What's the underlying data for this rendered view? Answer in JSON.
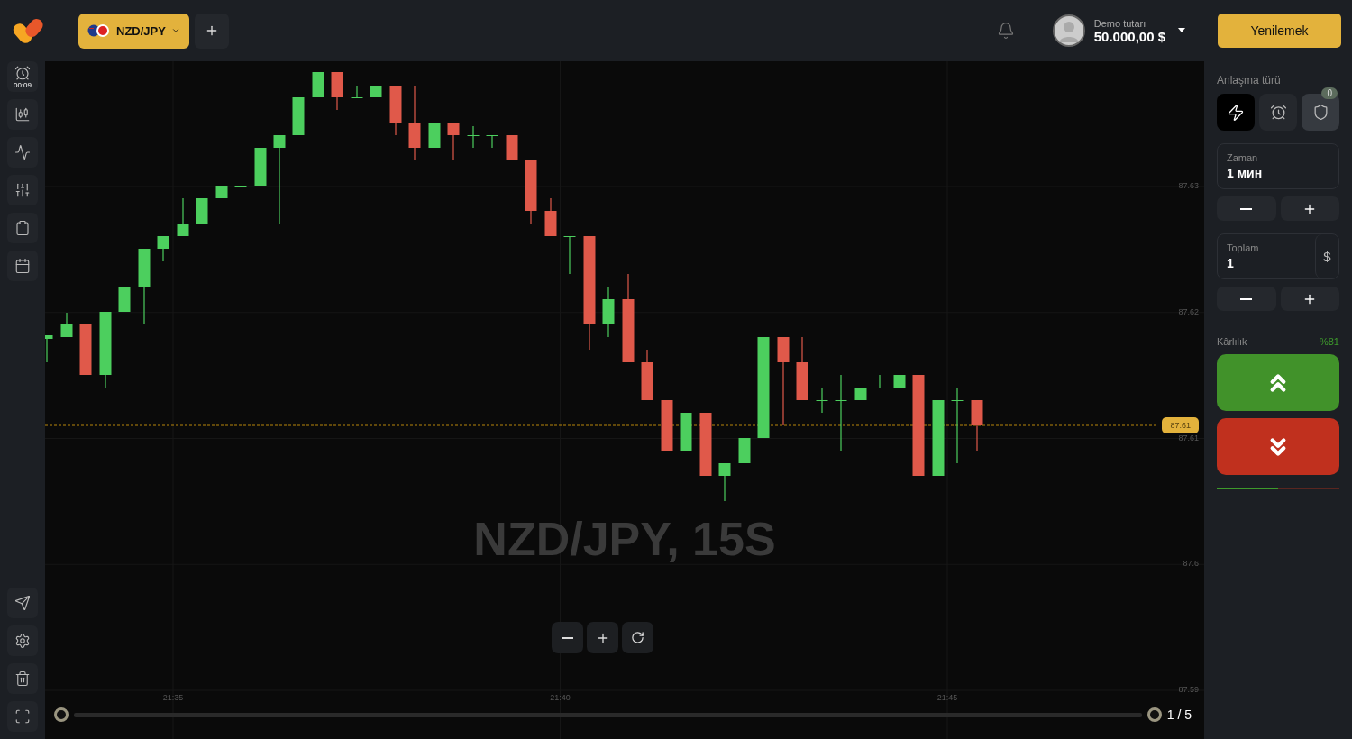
{
  "header": {
    "asset": {
      "label": "NZD/JPY"
    },
    "account": {
      "label": "Demo tutarı",
      "balance": "50.000,00 $"
    },
    "refill_button": "Yenilemek"
  },
  "sidebar": {
    "timer": "00:09"
  },
  "chart": {
    "watermark": "NZD/JPY, 15S",
    "price_ticks": [
      "87.63",
      "87.62",
      "87.61",
      "87.6",
      "87.59"
    ],
    "time_ticks": [
      "21:35",
      "21:40",
      "21:45"
    ],
    "current_price": "87.61",
    "page_indicator": "1 / 5"
  },
  "trade_panel": {
    "deal_type_label": "Anlaşma türü",
    "deal_types": [
      {
        "kind": "flash",
        "selected": true
      },
      {
        "kind": "timer",
        "selected": false
      },
      {
        "kind": "shield",
        "selected": false,
        "badge": "0"
      }
    ],
    "time": {
      "label": "Zaman",
      "value": "1 мин"
    },
    "amount": {
      "label": "Toplam",
      "value": "1",
      "currency": "$"
    },
    "profit": {
      "label": "Kârlılık",
      "value": "%81"
    },
    "sentiment": {
      "level": 0.5
    }
  }
}
